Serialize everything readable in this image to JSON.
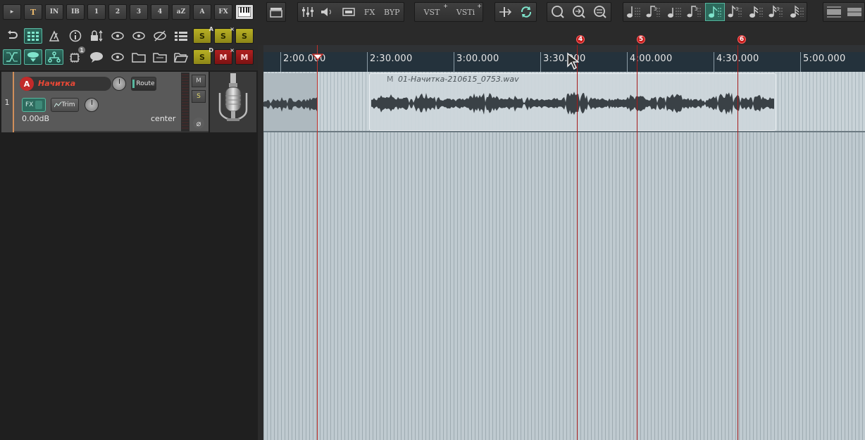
{
  "toolbar_left": {
    "row1": [
      {
        "label": "▸",
        "icon": "play-icon"
      },
      {
        "label": "T"
      },
      {
        "label": "IN"
      },
      {
        "label": "IB"
      },
      {
        "label": "1"
      },
      {
        "label": "2"
      },
      {
        "label": "3"
      },
      {
        "label": "4"
      },
      {
        "label": "aZ"
      },
      {
        "label": "A"
      },
      {
        "label": "FX"
      },
      {
        "label": "",
        "icon": "piano-icon"
      }
    ],
    "row2_sup": [
      "A",
      "×"
    ],
    "row2_s_labels": [
      "S",
      "S",
      "S"
    ],
    "row3_labels": [
      "S",
      "M",
      "M"
    ],
    "row3_sup": [
      "D",
      "×"
    ],
    "row3_badge": "1"
  },
  "toolbar_top": {
    "fx_label": "FX",
    "byp_label": "BYP",
    "vst_label": "VST",
    "vsti_label": "VSTi",
    "plus": "+"
  },
  "timeline": {
    "ticks": [
      "2:00.000",
      "2:30.000",
      "3:00.000",
      "3:30.000",
      "4:00.000",
      "4:30.000",
      "5:00.000"
    ],
    "markers": [
      "4",
      "5",
      "6"
    ]
  },
  "track": {
    "number": "1",
    "arm_label": "A",
    "name": "Начитка",
    "route_label": "Route",
    "fx_label": "FX",
    "trim_label": "Trim",
    "volume": "0.00dB",
    "pan": "center",
    "mute_label": "M",
    "solo_label": "S",
    "phase_symbol": "⌀",
    "icon": "microphone-icon"
  },
  "item": {
    "mute_label": "M",
    "name": "01-Начитка-210615_0753.wav"
  },
  "colors": {
    "accent": "#2e6b5e",
    "marker": "#c21b1b",
    "track_name": "#e94836"
  }
}
